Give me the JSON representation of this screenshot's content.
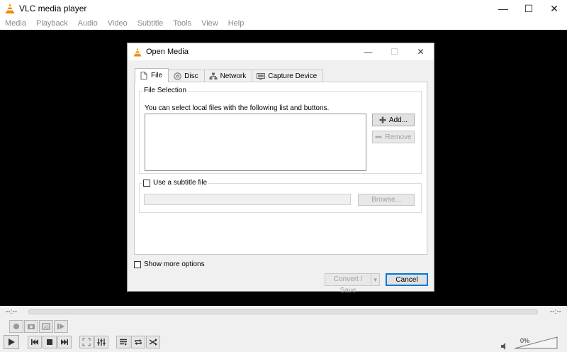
{
  "window": {
    "title": "VLC media player",
    "minimize": "—",
    "maximize": "☐",
    "close": "✕"
  },
  "menu": [
    "Media",
    "Playback",
    "Audio",
    "Video",
    "Subtitle",
    "Tools",
    "View",
    "Help"
  ],
  "player": {
    "time_elapsed": "--:--",
    "time_total": "--:--",
    "volume": "0%",
    "volume_fraction": 0
  },
  "dialog": {
    "title": "Open Media",
    "tabs": [
      {
        "label": "File",
        "icon": "file-icon",
        "selected": true
      },
      {
        "label": "Disc",
        "icon": "disc-icon",
        "selected": false
      },
      {
        "label": "Network",
        "icon": "network-icon",
        "selected": false
      },
      {
        "label": "Capture Device",
        "icon": "capture-device-icon",
        "selected": false
      }
    ],
    "file_selection": {
      "group_label": "File Selection",
      "description": "You can select local files with the following list and buttons.",
      "add_label": "Add...",
      "remove_label": "Remove"
    },
    "subtitle": {
      "checkbox_label": "Use a subtitle file",
      "checked": false,
      "path_value": "",
      "browse_label": "Browse..."
    },
    "show_more_options": {
      "label": "Show more options",
      "checked": false
    },
    "convert_label": "Convert / Save",
    "cancel_label": "Cancel"
  },
  "colors": {
    "accent": "#0078d7",
    "vlc_orange": "#f08a00",
    "video_bg": "#000000"
  }
}
